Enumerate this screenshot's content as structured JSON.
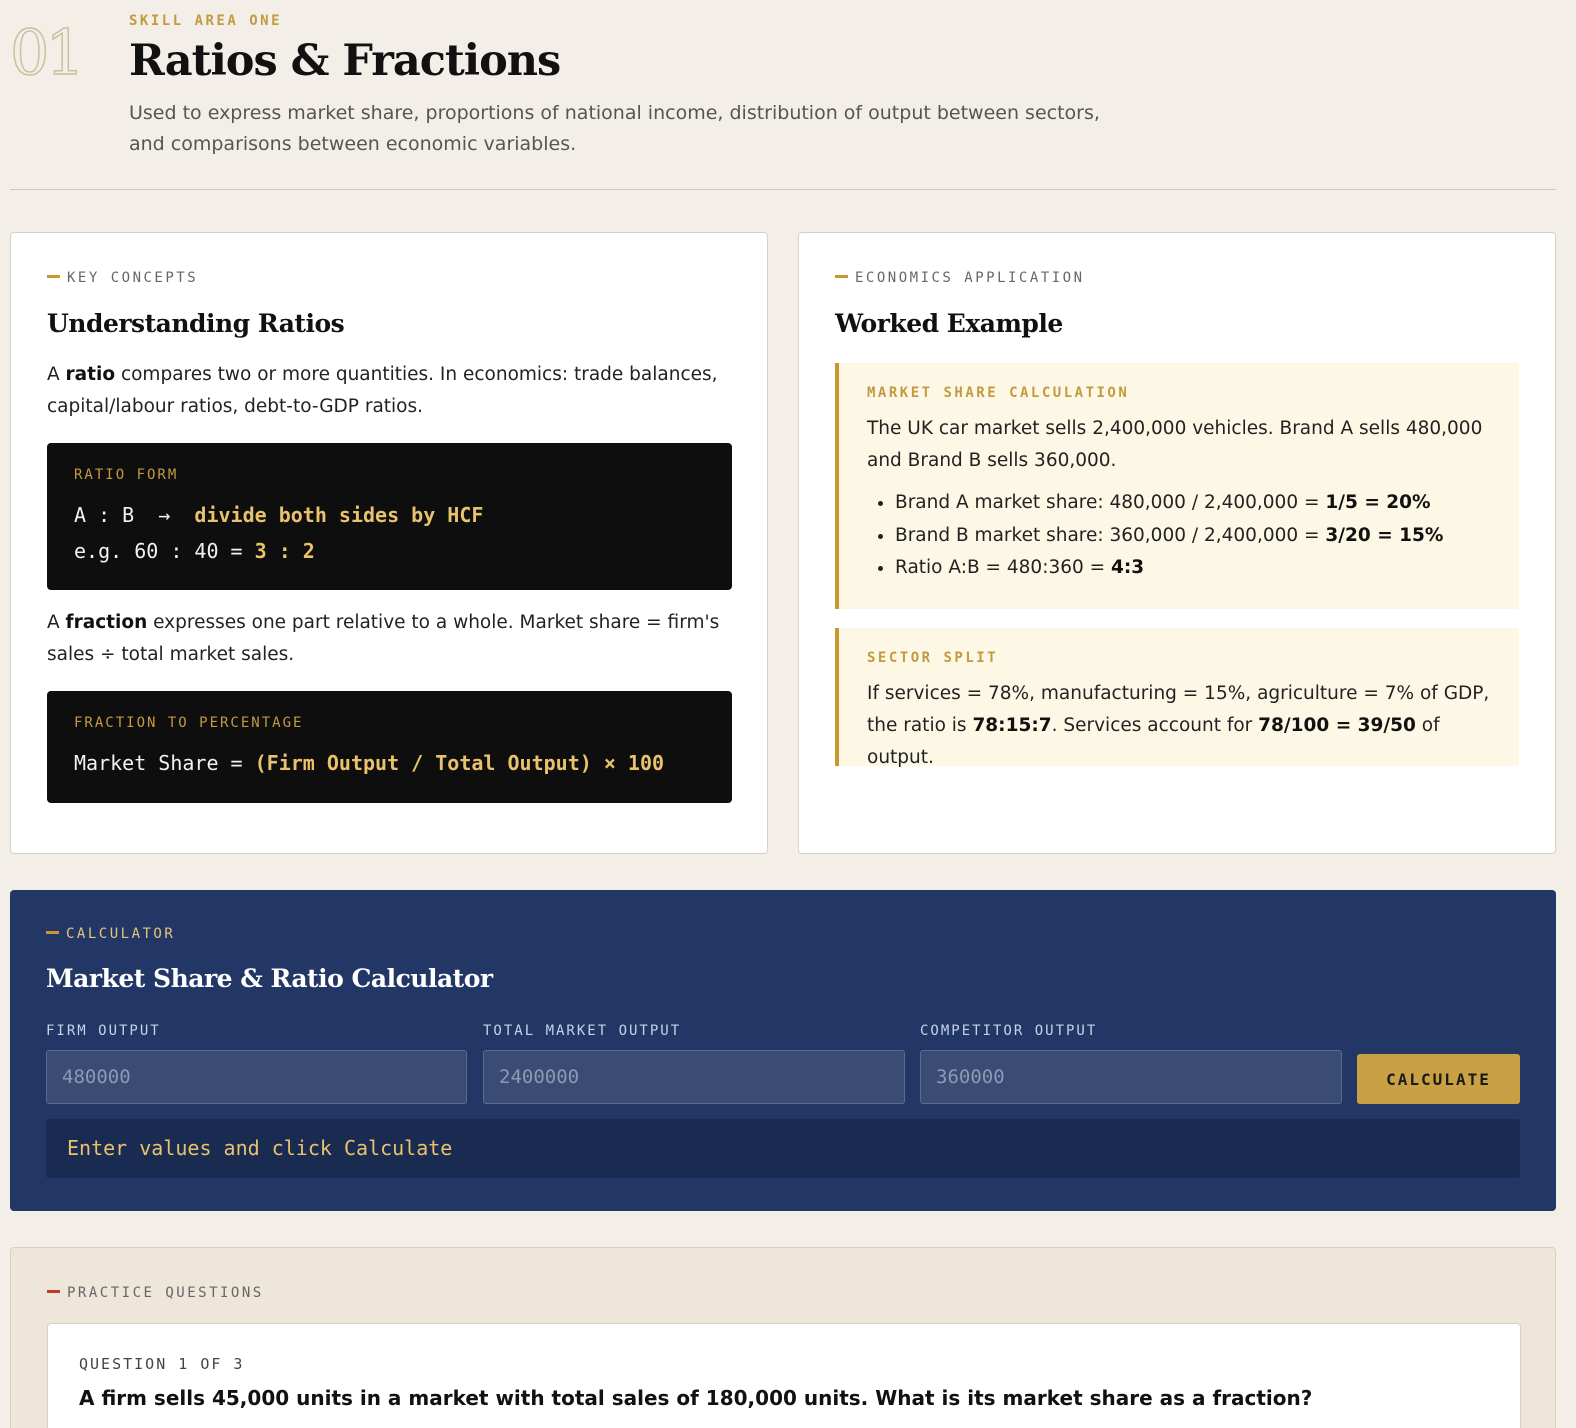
{
  "header": {
    "number": "01",
    "eyebrow": "SKILL AREA ONE",
    "title": "Ratios & Fractions",
    "subtitle": "Used to express market share, proportions of national income, distribution of output between sectors, and comparisons between economic variables."
  },
  "key_concepts": {
    "kicker": "KEY CONCEPTS",
    "title": "Understanding Ratios",
    "ratio_para": {
      "pre": "A ",
      "bold": "ratio",
      "post": " compares two or more quantities. In economics: trade balances, capital/labour ratios, debt-to-GDP ratios."
    },
    "ratio_box": {
      "label": "RATIO FORM",
      "line1_plain": "A : B  →  ",
      "line1_hl": "divide both sides by HCF",
      "line2_plain": "e.g. 60 : 40 = ",
      "line2_hl": "3 : 2"
    },
    "fraction_para": {
      "pre": "A ",
      "bold": "fraction",
      "post": " expresses one part relative to a whole. Market share = firm's sales ÷ total market sales."
    },
    "fraction_box": {
      "label": "FRACTION TO PERCENTAGE",
      "line_plain": "Market Share = ",
      "line_hl": "(Firm Output / Total Output) × 100"
    }
  },
  "application": {
    "kicker": "ECONOMICS APPLICATION",
    "title": "Worked Example",
    "market_share": {
      "label": "MARKET SHARE CALCULATION",
      "text": "The UK car market sells 2,400,000 vehicles. Brand A sells 480,000 and Brand B sells 360,000.",
      "items": [
        {
          "plain": "Brand A market share: 480,000 / 2,400,000 = ",
          "bold": "1/5 = 20%"
        },
        {
          "plain": "Brand B market share: 360,000 / 2,400,000 = ",
          "bold": "3/20 = 15%"
        },
        {
          "plain": "Ratio A:B = 480:360 = ",
          "bold": "4:3"
        }
      ]
    },
    "sector_split": {
      "label": "SECTOR SPLIT",
      "t1": "If services = 78%, manufacturing = 15%, agriculture = 7% of GDP, the ratio is ",
      "b1": "78:15:7",
      "t2": ". Services account for ",
      "b2": "78/100 = 39/50",
      "t3": " of output."
    }
  },
  "calculator": {
    "kicker": "CALCULATOR",
    "title": "Market Share & Ratio Calculator",
    "firm_label": "FIRM OUTPUT",
    "firm_placeholder": "480000",
    "total_label": "TOTAL MARKET OUTPUT",
    "total_placeholder": "2400000",
    "competitor_label": "COMPETITOR OUTPUT",
    "competitor_placeholder": "360000",
    "button": "CALCULATE",
    "result": "Enter values and click Calculate"
  },
  "practice": {
    "kicker": "PRACTICE QUESTIONS",
    "counter": "QUESTION 1 OF 3",
    "question": "A firm sells 45,000 units in a market with total sales of 180,000 units. What is its market share as a fraction?"
  },
  "colors": {
    "background": "#f3efe8",
    "accent_gold": "#c9962f",
    "calculator_navy": "#223766",
    "practice_dash_red": "#c0392b"
  }
}
